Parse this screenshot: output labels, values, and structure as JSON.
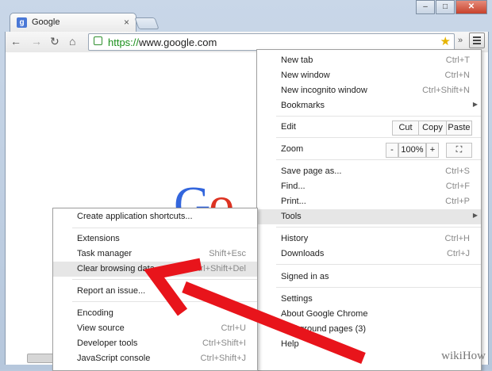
{
  "browser": {
    "tab_title": "Google",
    "tab_favicon": "g-favicon",
    "tab_close": "×",
    "url_scheme": "https://",
    "url_host": "www.google.com",
    "overflow": "»",
    "window_buttons": [
      "–",
      "□",
      "✕"
    ]
  },
  "page": {
    "logo_partial": [
      "G",
      "o",
      "o"
    ]
  },
  "main_menu": {
    "new_tab": {
      "label": "New tab",
      "shortcut": "Ctrl+T"
    },
    "new_window": {
      "label": "New window",
      "shortcut": "Ctrl+N"
    },
    "new_incognito": {
      "label": "New incognito window",
      "shortcut": "Ctrl+Shift+N"
    },
    "bookmarks": {
      "label": "Bookmarks"
    },
    "edit": {
      "label": "Edit",
      "cut": "Cut",
      "copy": "Copy",
      "paste": "Paste"
    },
    "zoom": {
      "label": "Zoom",
      "minus": "-",
      "value": "100%",
      "plus": "+"
    },
    "save_page": {
      "label": "Save page as...",
      "shortcut": "Ctrl+S"
    },
    "find": {
      "label": "Find...",
      "shortcut": "Ctrl+F"
    },
    "print": {
      "label": "Print...",
      "shortcut": "Ctrl+P"
    },
    "tools": {
      "label": "Tools"
    },
    "history": {
      "label": "History",
      "shortcut": "Ctrl+H"
    },
    "downloads": {
      "label": "Downloads",
      "shortcut": "Ctrl+J"
    },
    "signed_in": {
      "label": "Signed in as"
    },
    "settings": {
      "label": "Settings"
    },
    "about": {
      "label": "About Google Chrome"
    },
    "background": {
      "label": "background pages (3)"
    },
    "help": {
      "label": "Help"
    }
  },
  "tools_menu": {
    "create_shortcuts": {
      "label": "Create application shortcuts..."
    },
    "extensions": {
      "label": "Extensions"
    },
    "task_manager": {
      "label": "Task manager",
      "shortcut": "Shift+Esc"
    },
    "clear_browsing": {
      "label": "Clear browsing data...",
      "shortcut": "Ctrl+Shift+Del"
    },
    "report_issue": {
      "label": "Report an issue..."
    },
    "encoding": {
      "label": "Encoding"
    },
    "view_source": {
      "label": "View source",
      "shortcut": "Ctrl+U"
    },
    "developer_tools": {
      "label": "Developer tools",
      "shortcut": "Ctrl+Shift+I"
    },
    "js_console": {
      "label": "JavaScript console",
      "shortcut": "Ctrl+Shift+J"
    }
  },
  "watermark": "wikiHow",
  "colors": {
    "arrow": "#e8141b",
    "secure": "#1a8f1a"
  }
}
